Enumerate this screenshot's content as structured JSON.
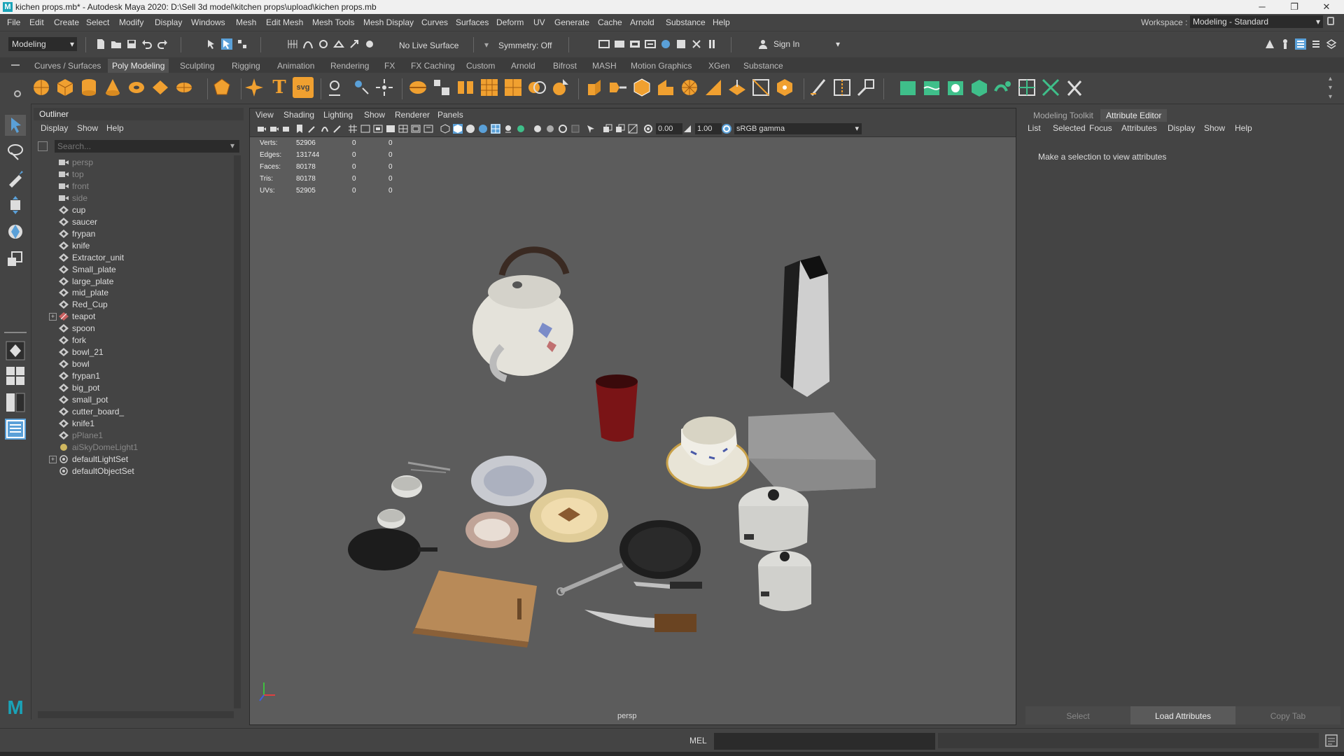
{
  "titlebar": {
    "title": "kichen props.mb* - Autodesk Maya 2020: D:\\Sell 3d model\\kitchen props\\upload\\kichen props.mb",
    "minimize": "─",
    "restore": "❐",
    "close": "✕"
  },
  "menubar": {
    "items": [
      "File",
      "Edit",
      "Create",
      "Select",
      "Modify",
      "Display",
      "Windows",
      "Mesh",
      "Edit Mesh",
      "Mesh Tools",
      "Mesh Display",
      "Curves",
      "Surfaces",
      "Deform",
      "UV",
      "Generate",
      "Cache",
      "Arnold",
      "Substance",
      "Help"
    ],
    "workspace_label": "Workspace :",
    "workspace_value": "Modeling - Standard"
  },
  "statusline": {
    "mode": "Modeling",
    "live_surface": "No Live Surface",
    "symmetry": "Symmetry: Off",
    "sign_in": "Sign In"
  },
  "shelf": {
    "tabs": [
      "Curves / Surfaces",
      "Poly Modeling",
      "Sculpting",
      "Rigging",
      "Animation",
      "Rendering",
      "FX",
      "FX Caching",
      "Custom",
      "Arnold",
      "Bifrost",
      "MASH",
      "Motion Graphics",
      "XGen",
      "Substance"
    ],
    "active_tab": "Poly Modeling",
    "text_icon": "T",
    "svg_icon": "svg"
  },
  "outliner": {
    "title": "Outliner",
    "menu": [
      "Display",
      "Show",
      "Help"
    ],
    "search_placeholder": "Search...",
    "items": [
      {
        "label": "persp",
        "icon": "camera-icon",
        "dim": true,
        "expand": ""
      },
      {
        "label": "top",
        "icon": "camera-icon",
        "dim": true,
        "expand": ""
      },
      {
        "label": "front",
        "icon": "camera-icon",
        "dim": true,
        "expand": ""
      },
      {
        "label": "side",
        "icon": "camera-icon",
        "dim": true,
        "expand": ""
      },
      {
        "label": "cup",
        "icon": "mesh-icon",
        "dim": false,
        "expand": ""
      },
      {
        "label": "saucer",
        "icon": "mesh-icon",
        "dim": false,
        "expand": ""
      },
      {
        "label": "frypan",
        "icon": "mesh-icon",
        "dim": false,
        "expand": ""
      },
      {
        "label": "knife",
        "icon": "mesh-icon",
        "dim": false,
        "expand": ""
      },
      {
        "label": "Extractor_unit",
        "icon": "mesh-icon",
        "dim": false,
        "expand": ""
      },
      {
        "label": "Small_plate",
        "icon": "mesh-icon",
        "dim": false,
        "expand": ""
      },
      {
        "label": "large_plate",
        "icon": "mesh-icon",
        "dim": false,
        "expand": ""
      },
      {
        "label": "mid_plate",
        "icon": "mesh-icon",
        "dim": false,
        "expand": ""
      },
      {
        "label": "Red_Cup",
        "icon": "mesh-icon",
        "dim": false,
        "expand": ""
      },
      {
        "label": "teapot",
        "icon": "group-icon",
        "dim": false,
        "expand": "+"
      },
      {
        "label": "spoon",
        "icon": "mesh-icon",
        "dim": false,
        "expand": ""
      },
      {
        "label": "fork",
        "icon": "mesh-icon",
        "dim": false,
        "expand": ""
      },
      {
        "label": "bowl_21",
        "icon": "mesh-icon",
        "dim": false,
        "expand": ""
      },
      {
        "label": "bowl",
        "icon": "mesh-icon",
        "dim": false,
        "expand": ""
      },
      {
        "label": "frypan1",
        "icon": "mesh-icon",
        "dim": false,
        "expand": ""
      },
      {
        "label": "big_pot",
        "icon": "mesh-icon",
        "dim": false,
        "expand": ""
      },
      {
        "label": "small_pot",
        "icon": "mesh-icon",
        "dim": false,
        "expand": ""
      },
      {
        "label": "cutter_board_",
        "icon": "mesh-icon",
        "dim": false,
        "expand": ""
      },
      {
        "label": "knife1",
        "icon": "mesh-icon",
        "dim": false,
        "expand": ""
      },
      {
        "label": "pPlane1",
        "icon": "mesh-icon",
        "dim": true,
        "expand": ""
      },
      {
        "label": "aiSkyDomeLight1",
        "icon": "light-icon",
        "dim": true,
        "expand": ""
      },
      {
        "label": "defaultLightSet",
        "icon": "set-icon",
        "dim": false,
        "expand": "+"
      },
      {
        "label": "defaultObjectSet",
        "icon": "set-icon",
        "dim": false,
        "expand": ""
      }
    ]
  },
  "viewport": {
    "menu": [
      "View",
      "Shading",
      "Lighting",
      "Show",
      "Renderer",
      "Panels"
    ],
    "exposure": "0.00",
    "gamma": "1.00",
    "color_space": "sRGB gamma",
    "hud": [
      {
        "label": "Verts:",
        "v1": "52906",
        "v2": "0",
        "v3": "0"
      },
      {
        "label": "Edges:",
        "v1": "131744",
        "v2": "0",
        "v3": "0"
      },
      {
        "label": "Faces:",
        "v1": "80178",
        "v2": "0",
        "v3": "0"
      },
      {
        "label": "Tris:",
        "v1": "80178",
        "v2": "0",
        "v3": "0"
      },
      {
        "label": "UVs:",
        "v1": "52905",
        "v2": "0",
        "v3": "0"
      }
    ],
    "camera_label": "persp"
  },
  "attribute_editor": {
    "tabs": [
      "Modeling Toolkit",
      "Attribute Editor"
    ],
    "active_tab": "Attribute Editor",
    "menu": [
      "List",
      "Selected",
      "Focus",
      "Attributes",
      "Display",
      "Show",
      "Help"
    ],
    "message": "Make a selection to view attributes",
    "buttons": [
      "Select",
      "Load Attributes",
      "Copy Tab"
    ]
  },
  "cmdline": {
    "label": "MEL"
  },
  "colors": {
    "accent_orange": "#f0a030",
    "accent_green": "#3fbf8a",
    "selection_blue": "#5aa0d8"
  }
}
